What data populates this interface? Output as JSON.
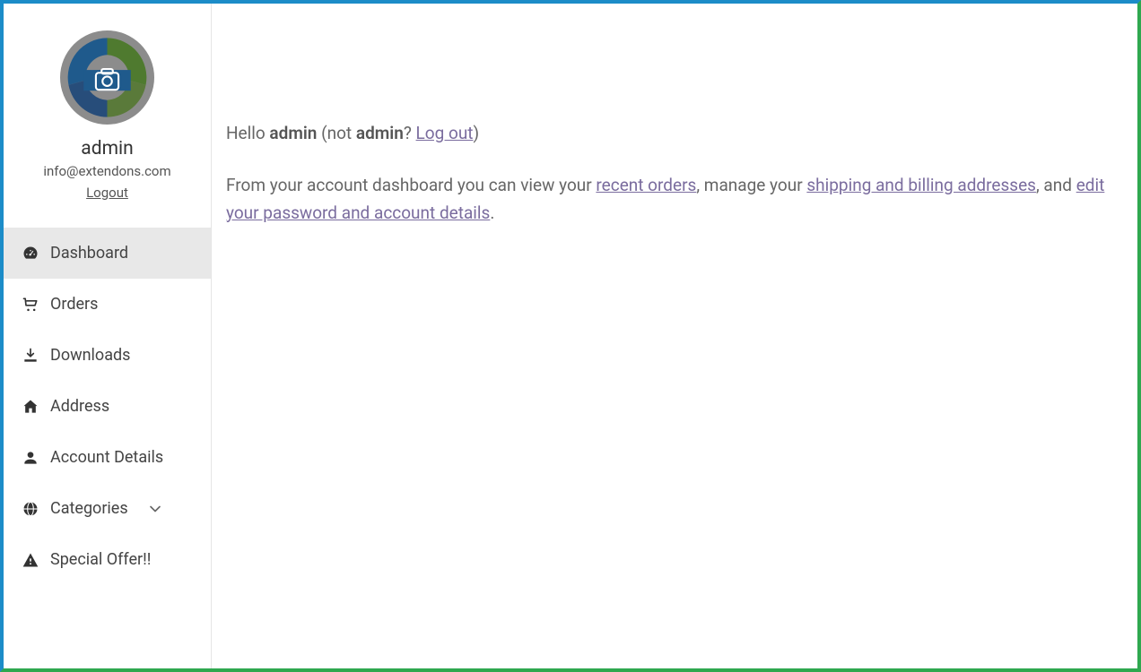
{
  "user": {
    "name": "admin",
    "email": "info@extendons.com",
    "logout_label": "Logout"
  },
  "sidebar": {
    "items": [
      {
        "label": "Dashboard"
      },
      {
        "label": "Orders"
      },
      {
        "label": "Downloads"
      },
      {
        "label": "Address"
      },
      {
        "label": "Account Details"
      },
      {
        "label": "Categories"
      },
      {
        "label": "Special Offer!!"
      }
    ]
  },
  "main": {
    "greeting_prefix": "Hello ",
    "greeting_name": "admin",
    "greeting_not_prefix": " (not ",
    "greeting_not_name": "admin",
    "greeting_not_suffix": "? ",
    "logout_link": "Log out",
    "greeting_close": ")",
    "body_1": "From your account dashboard you can view your ",
    "link_orders": "recent orders",
    "body_2": ", manage your ",
    "link_addresses": "shipping and billing addresses",
    "body_3": ", and ",
    "link_account": "edit your password and account details",
    "body_4": "."
  }
}
